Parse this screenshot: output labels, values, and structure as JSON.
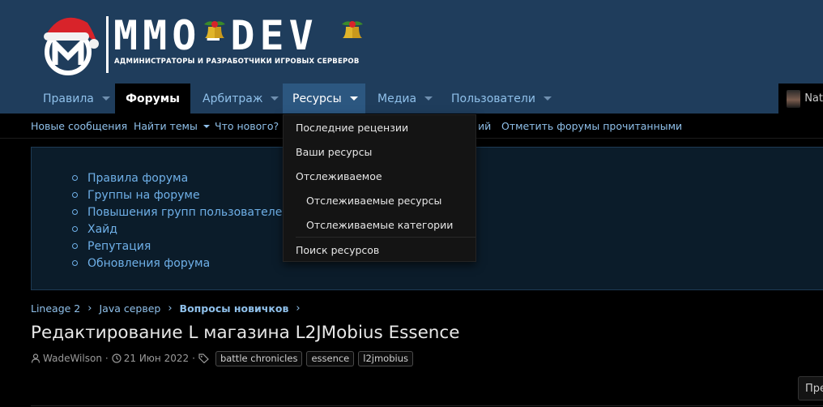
{
  "brand": {
    "logo_text": "MMO-DEV",
    "tagline": "АДМИНИСТРАТОРЫ И РАЗРАБОТЧИКИ ИГРОВЫХ СЕРВЕРОВ"
  },
  "nav": {
    "tabs": [
      {
        "label": "Правила",
        "state": "normal"
      },
      {
        "label": "Форумы",
        "state": "active"
      },
      {
        "label": "Арбитраж",
        "state": "normal"
      },
      {
        "label": "Ресурсы",
        "state": "open"
      },
      {
        "label": "Медиа",
        "state": "normal"
      },
      {
        "label": "Пользователи",
        "state": "normal"
      }
    ],
    "user_name": "Nat"
  },
  "subnav": {
    "links": [
      "Новые сообщения",
      "Найти темы",
      "Что нового?",
      "ий",
      "Отметить форумы прочитанными"
    ]
  },
  "notice": {
    "links": [
      "Правила форума",
      "Группы на форуме",
      "Повышения групп пользователей",
      "Хайд",
      "Репутация",
      "Обновления форума"
    ]
  },
  "breadcrumbs": [
    "Lineage 2",
    "Java сервер",
    "Вопросы новичков"
  ],
  "thread": {
    "title": "Редактирование L магазина L2JMobius Essence",
    "author": "WadeWilson",
    "date": "21 Июн 2022",
    "tags": [
      "battle chronicles",
      "essence",
      "l2jmobius"
    ]
  },
  "corner_button": "Пре",
  "dropdown": {
    "items": [
      "Последние рецензии",
      "Ваши ресурсы",
      "Отслеживаемое",
      "Отслеживаемые ресурсы",
      "Отслеживаемые категории",
      "Поиск ресурсов"
    ]
  },
  "colors": {
    "header_bg": "#1f3d5c",
    "link": "#8fc0ea",
    "dropdown_bg": "#141414",
    "hat_red": "#d8232a"
  }
}
